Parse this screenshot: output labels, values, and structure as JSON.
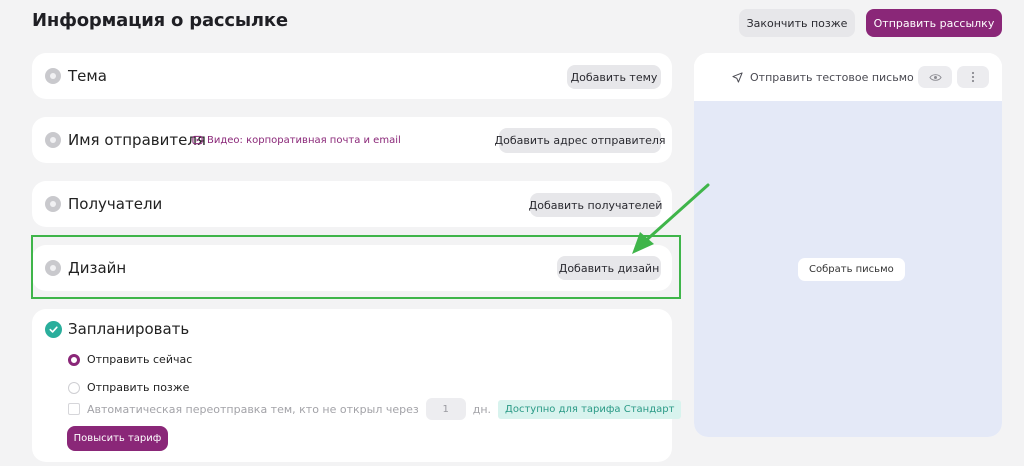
{
  "header": {
    "title": "Информация о рассылке",
    "finish_later_label": "Закончить позже",
    "send_label": "Отправить рассылку"
  },
  "sections": {
    "subject": {
      "title": "Тема",
      "button": "Добавить тему"
    },
    "sender": {
      "title": "Имя отправителя",
      "video_link": "Видео: корпоративная почта и email",
      "button": "Добавить адрес отправителя"
    },
    "recipients": {
      "title": "Получатели",
      "button": "Добавить получателей"
    },
    "design": {
      "title": "Дизайн",
      "button": "Добавить дизайн"
    }
  },
  "schedule": {
    "title": "Запланировать",
    "send_now": "Отправить сейчас",
    "send_later": "Отправить позже",
    "auto_resend": "Автоматическая переотправка тем, кто не открыл через",
    "days_value": "1",
    "days_unit": "дн.",
    "tariff_badge": "Доступно для тарифа Стандарт",
    "upgrade_button": "Повысить тариф",
    "send_now_selected": true
  },
  "preview": {
    "send_test_label": "Отправить тестовое письмо",
    "compose_label": "Собрать письмо"
  },
  "colors": {
    "accent": "#8a2778",
    "success": "#2aae9c",
    "highlight_border": "#3fb54a",
    "preview_bg": "#e4e9f7"
  },
  "icons": [
    "info-circle-icon",
    "play-video-icon",
    "check-icon",
    "send-icon",
    "eye-icon",
    "more-vertical-icon",
    "arrow-annotation-icon"
  ]
}
